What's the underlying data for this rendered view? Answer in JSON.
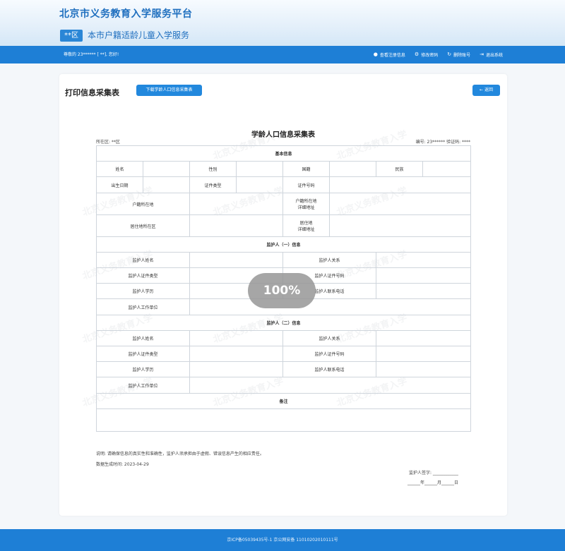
{
  "header": {
    "site_title": "北京市义务教育入学服务平台",
    "district_badge": "**区",
    "service_title": "本市户籍适龄儿童入学服务"
  },
  "nav": {
    "welcome": "尊敬的 23****** [ **], 您好!",
    "links": [
      {
        "label": "查看注册信息",
        "icon": "user-circle-icon",
        "glyph": "●"
      },
      {
        "label": "修改密码",
        "icon": "gear-icon",
        "glyph": "⚙"
      },
      {
        "label": "删除账号",
        "icon": "refresh-icon",
        "glyph": "↻"
      },
      {
        "label": "退出系统",
        "icon": "logout-icon",
        "glyph": "⇥"
      }
    ]
  },
  "page": {
    "title": "打印信息采集表",
    "download_button": "下载学龄人口信息采集表",
    "back_button": "返回",
    "back_glyph": "←"
  },
  "form": {
    "title": "学龄人口信息采集表",
    "district_line": "所在区: **区",
    "serial_line": "编号: 23****** 验证码: ****",
    "basic": {
      "section": "基本信息",
      "name": "姓名",
      "gender": "性别",
      "nationality": "国籍",
      "ethnicity": "民族",
      "birth_date": "出生日期",
      "id_type": "证件类型",
      "id_number": "证件号码",
      "hukou_place": "户籍所在地",
      "hukou_address_1": "户籍所在地",
      "hukou_address_2": "详细地址",
      "residence_district": "居住地所在区",
      "residence_address_1": "居住地",
      "residence_address_2": "详细地址"
    },
    "guardian1": {
      "section": "监护人（一）信息",
      "name": "监护人姓名",
      "relation": "监护人关系",
      "id_type": "监护人证件类型",
      "id_number": "监护人证件号码",
      "education": "监护人学历",
      "phone": "监护人联系电话",
      "employer": "监护人工作单位"
    },
    "guardian2": {
      "section": "监护人（二）信息",
      "name": "监护人姓名",
      "relation": "监护人关系",
      "id_type": "监护人证件类型",
      "id_number": "监护人证件号码",
      "education": "监护人学历",
      "phone": "监护人联系电话",
      "employer": "监护人工作单位"
    },
    "remark": "备注",
    "note": "说明: 请确保信息的真实性和准确性，监护人须承担由于虚假、错误信息产生的相应责任。",
    "generated": "数据生成时间: 2023-04-29",
    "signature": "监护人签字: ____________",
    "date": "______年______月______日",
    "watermark": "北京义务教育入学"
  },
  "zoom": "100%",
  "footer": "京ICP备05039435号-1 京公网安备 11010202010111号"
}
